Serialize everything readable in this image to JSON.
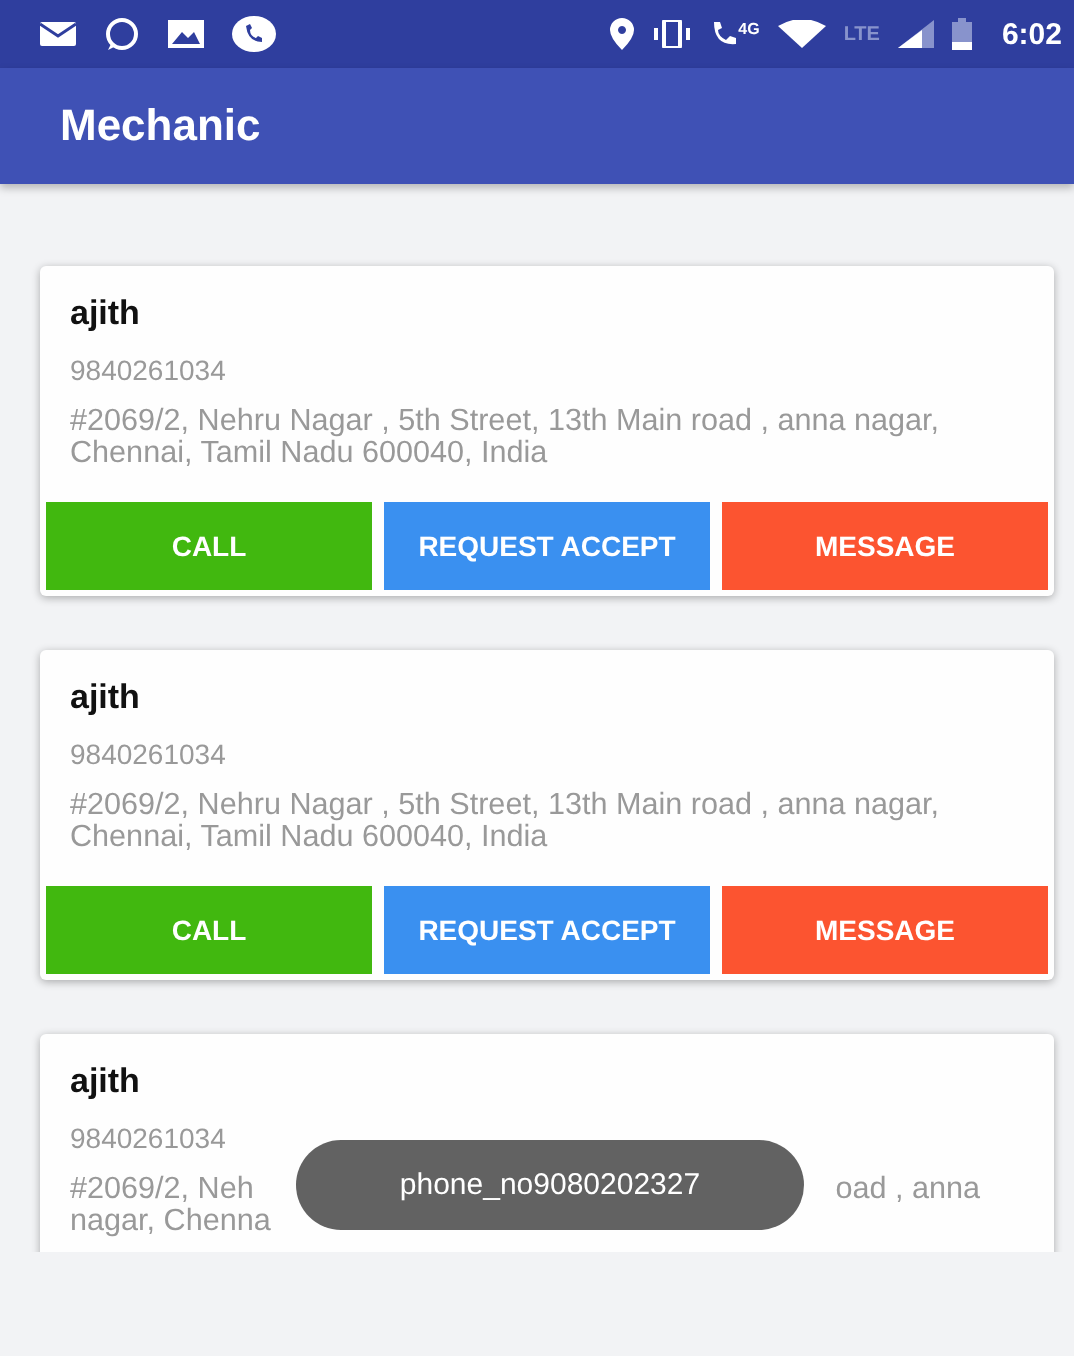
{
  "status_bar": {
    "network_label": "4G",
    "lte_label": "LTE",
    "time": "6:02"
  },
  "app_bar": {
    "title": "Mechanic"
  },
  "cards": [
    {
      "name": "ajith",
      "phone": "9840261034",
      "address": "#2069/2, Nehru Nagar , 5th Street, 13th Main road , anna nagar, Chennai, Tamil Nadu 600040, India",
      "buttons": [
        {
          "label": "CALL",
          "color": "#41b80f"
        },
        {
          "label": "REQUEST ACCEPT",
          "color": "#3a90f0"
        },
        {
          "label": "MESSAGE",
          "color": "#fc5430"
        }
      ]
    },
    {
      "name": "ajith",
      "phone": "9840261034",
      "address": "#2069/2, Nehru Nagar , 5th Street, 13th Main road , anna nagar, Chennai, Tamil Nadu 600040, India",
      "buttons": [
        {
          "label": "CALL",
          "color": "#41b80f"
        },
        {
          "label": "REQUEST ACCEPT",
          "color": "#3a90f0"
        },
        {
          "label": "MESSAGE",
          "color": "#fc5430"
        }
      ]
    },
    {
      "name": "ajith",
      "phone": "9840261034",
      "address_lines": [
        {
          "left": "#2069/2, Neh",
          "right": "oad , anna"
        },
        {
          "left": "nagar, Chenna"
        }
      ]
    }
  ],
  "toast": {
    "text": "phone_no9080202327"
  }
}
